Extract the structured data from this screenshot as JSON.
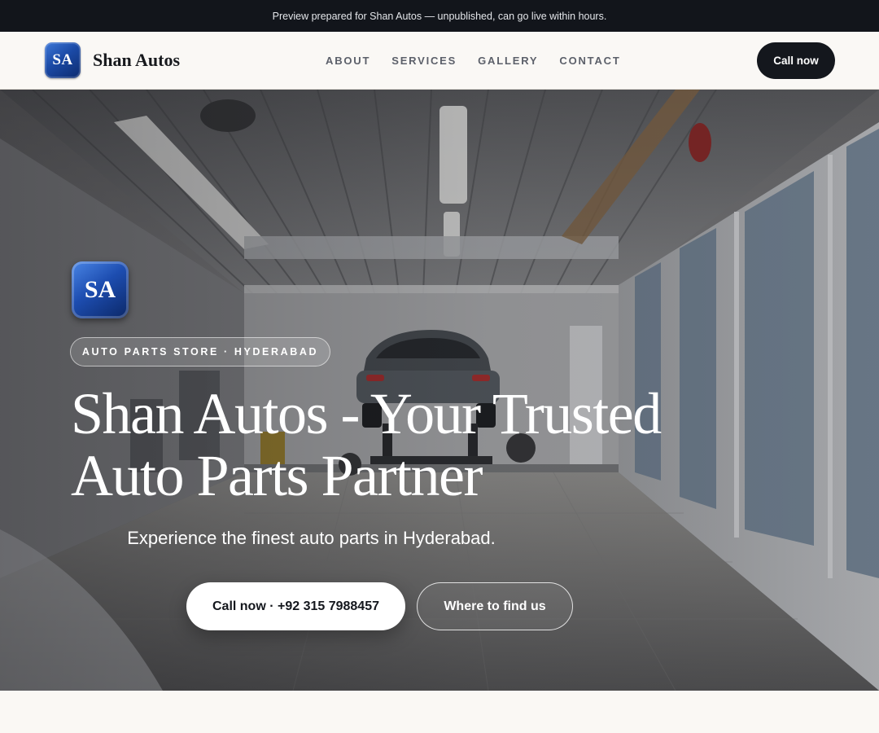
{
  "banner": {
    "text": "Preview prepared for Shan Autos — unpublished, can go live within hours."
  },
  "header": {
    "logo_text": "SA",
    "brand_name": "Shan Autos",
    "nav": [
      "ABOUT",
      "SERVICES",
      "GALLERY",
      "CONTACT"
    ],
    "cta_label": "Call now"
  },
  "hero": {
    "logo_text": "SA",
    "badge": "AUTO PARTS STORE · HYDERABAD",
    "title_line1": "Shan Autos - Your Trusted",
    "title_line2": "Auto Parts Partner",
    "subtitle": "Experience the finest auto parts in Hyderabad.",
    "primary_button": "Call now · +92 315 7988457",
    "secondary_button": "Where to find us",
    "background_image": "garage-workshop-photo"
  },
  "colors": {
    "banner_bg": "#12151b",
    "header_bg": "#faf8f5",
    "cta_bg": "#14171d",
    "logo_blue": "#1b4aa6",
    "page_bg": "#faf8f4"
  }
}
